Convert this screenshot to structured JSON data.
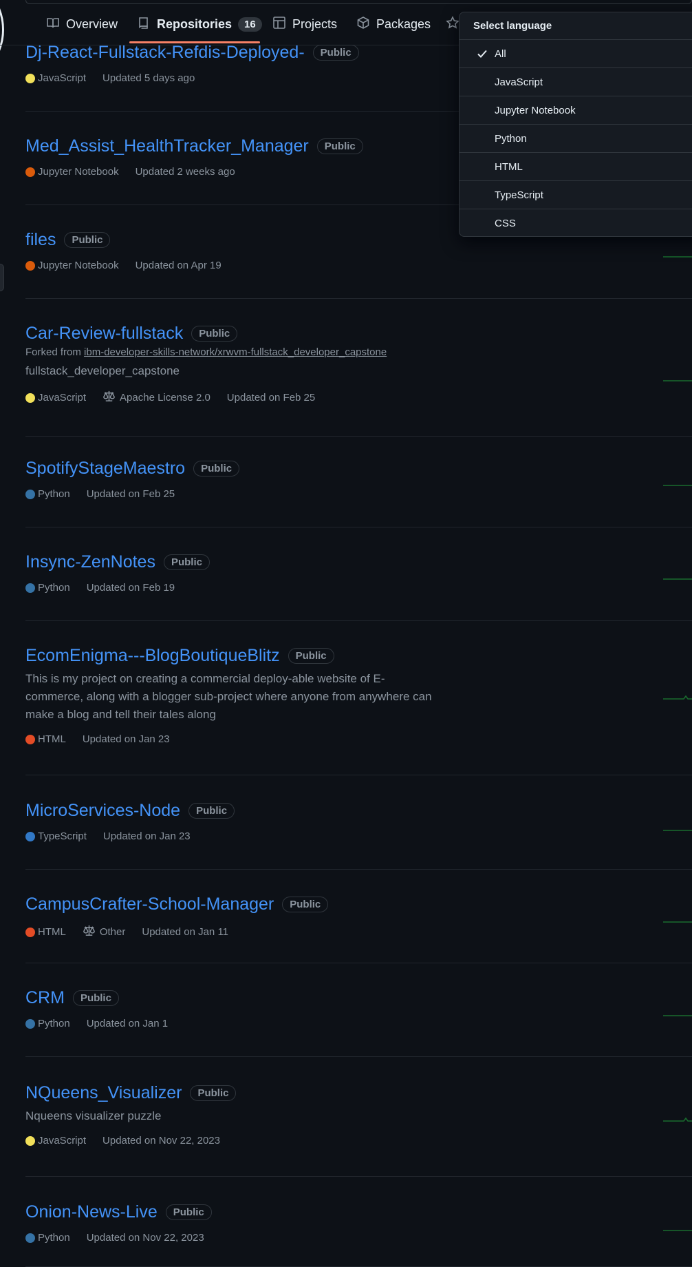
{
  "tabs": [
    {
      "label": "Overview",
      "icon": "book-icon"
    },
    {
      "label": "Repositories",
      "icon": "repo-icon",
      "count": "16",
      "active": true
    },
    {
      "label": "Projects",
      "icon": "table-icon"
    },
    {
      "label": "Packages",
      "icon": "package-icon"
    },
    {
      "label": "",
      "icon": "star-icon"
    }
  ],
  "language_dropdown": {
    "title": "Select language",
    "selected": "All",
    "options": [
      "All",
      "JavaScript",
      "Jupyter Notebook",
      "Python",
      "HTML",
      "TypeScript",
      "CSS"
    ]
  },
  "repos": [
    {
      "name": "Dj-React-Fullstack-Refdis-Deployed-",
      "visibility": "Public",
      "language": "JavaScript",
      "lang_color": "#f1e05a",
      "updated": "Updated 5 days ago"
    },
    {
      "name": "Med_Assist_HealthTracker_Manager",
      "visibility": "Public",
      "language": "Jupyter Notebook",
      "lang_color": "#DA5B0B",
      "updated": "Updated 2 weeks ago"
    },
    {
      "name": "files",
      "visibility": "Public",
      "language": "Jupyter Notebook",
      "lang_color": "#DA5B0B",
      "updated": "Updated on Apr 19"
    },
    {
      "name": "Car-Review-fullstack",
      "visibility": "Public",
      "forked_prefix": "Forked from",
      "forked_from": "ibm-developer-skills-network/xrwvm-fullstack_developer_capstone",
      "description": "fullstack_developer_capstone",
      "language": "JavaScript",
      "lang_color": "#f1e05a",
      "license": "Apache License 2.0",
      "updated": "Updated on Feb 25"
    },
    {
      "name": "SpotifyStageMaestro",
      "visibility": "Public",
      "language": "Python",
      "lang_color": "#3572A5",
      "updated": "Updated on Feb 25"
    },
    {
      "name": "Insync-ZenNotes",
      "visibility": "Public",
      "language": "Python",
      "lang_color": "#3572A5",
      "updated": "Updated on Feb 19"
    },
    {
      "name": "EcomEnigma---BlogBoutiqueBlitz",
      "visibility": "Public",
      "description": "This is my project on creating a commercial deploy-able website of E-commerce, along with a blogger sub-project where anyone from anywhere can make a blog and tell their tales along",
      "language": "HTML",
      "lang_color": "#e34c26",
      "updated": "Updated on Jan 23"
    },
    {
      "name": "MicroServices-Node",
      "visibility": "Public",
      "language": "TypeScript",
      "lang_color": "#3178c6",
      "updated": "Updated on Jan 23"
    },
    {
      "name": "CampusCrafter-School-Manager",
      "visibility": "Public",
      "language": "HTML",
      "lang_color": "#e34c26",
      "license": "Other",
      "updated": "Updated on Jan 11"
    },
    {
      "name": "CRM",
      "visibility": "Public",
      "language": "Python",
      "lang_color": "#3572A5",
      "updated": "Updated on Jan 1"
    },
    {
      "name": "NQueens_Visualizer",
      "visibility": "Public",
      "description": "Nqueens visualizer puzzle",
      "language": "JavaScript",
      "lang_color": "#f1e05a",
      "updated": "Updated on Nov 22, 2023"
    },
    {
      "name": "Onion-News-Live",
      "visibility": "Public",
      "language": "Python",
      "lang_color": "#3572A5",
      "updated": "Updated on Nov 22, 2023"
    }
  ]
}
